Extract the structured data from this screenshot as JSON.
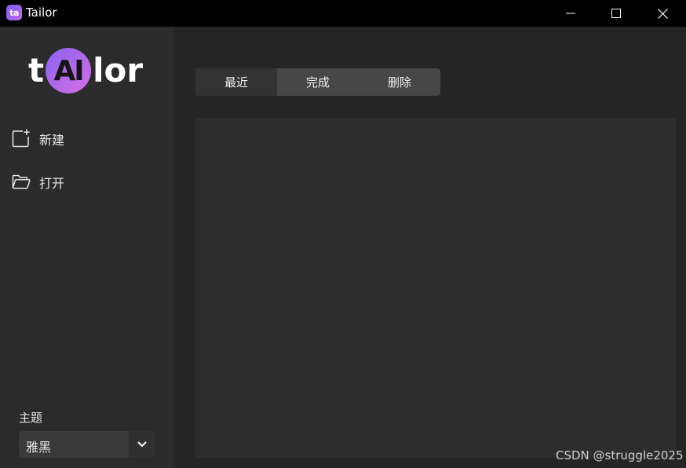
{
  "window": {
    "app_icon_text": "ta",
    "title": "Tailor"
  },
  "logo": {
    "prefix": "t",
    "circle": "AI",
    "suffix": "lor"
  },
  "sidebar": {
    "items": [
      {
        "label": "新建",
        "icon": "new-file-icon"
      },
      {
        "label": "打开",
        "icon": "folder-open-icon"
      }
    ],
    "theme_label": "主题",
    "theme_value": "雅黑"
  },
  "tabs": [
    {
      "label": "最近",
      "active": true
    },
    {
      "label": "完成",
      "active": false
    },
    {
      "label": "删除",
      "active": false
    }
  ],
  "watermark": "CSDN @struggle2025",
  "colors": {
    "background": "#252525",
    "sidebar": "#2b2b2b",
    "titlebar": "#000000",
    "accent_gradient_start": "#8a63f0",
    "accent_gradient_end": "#d56ee6"
  }
}
